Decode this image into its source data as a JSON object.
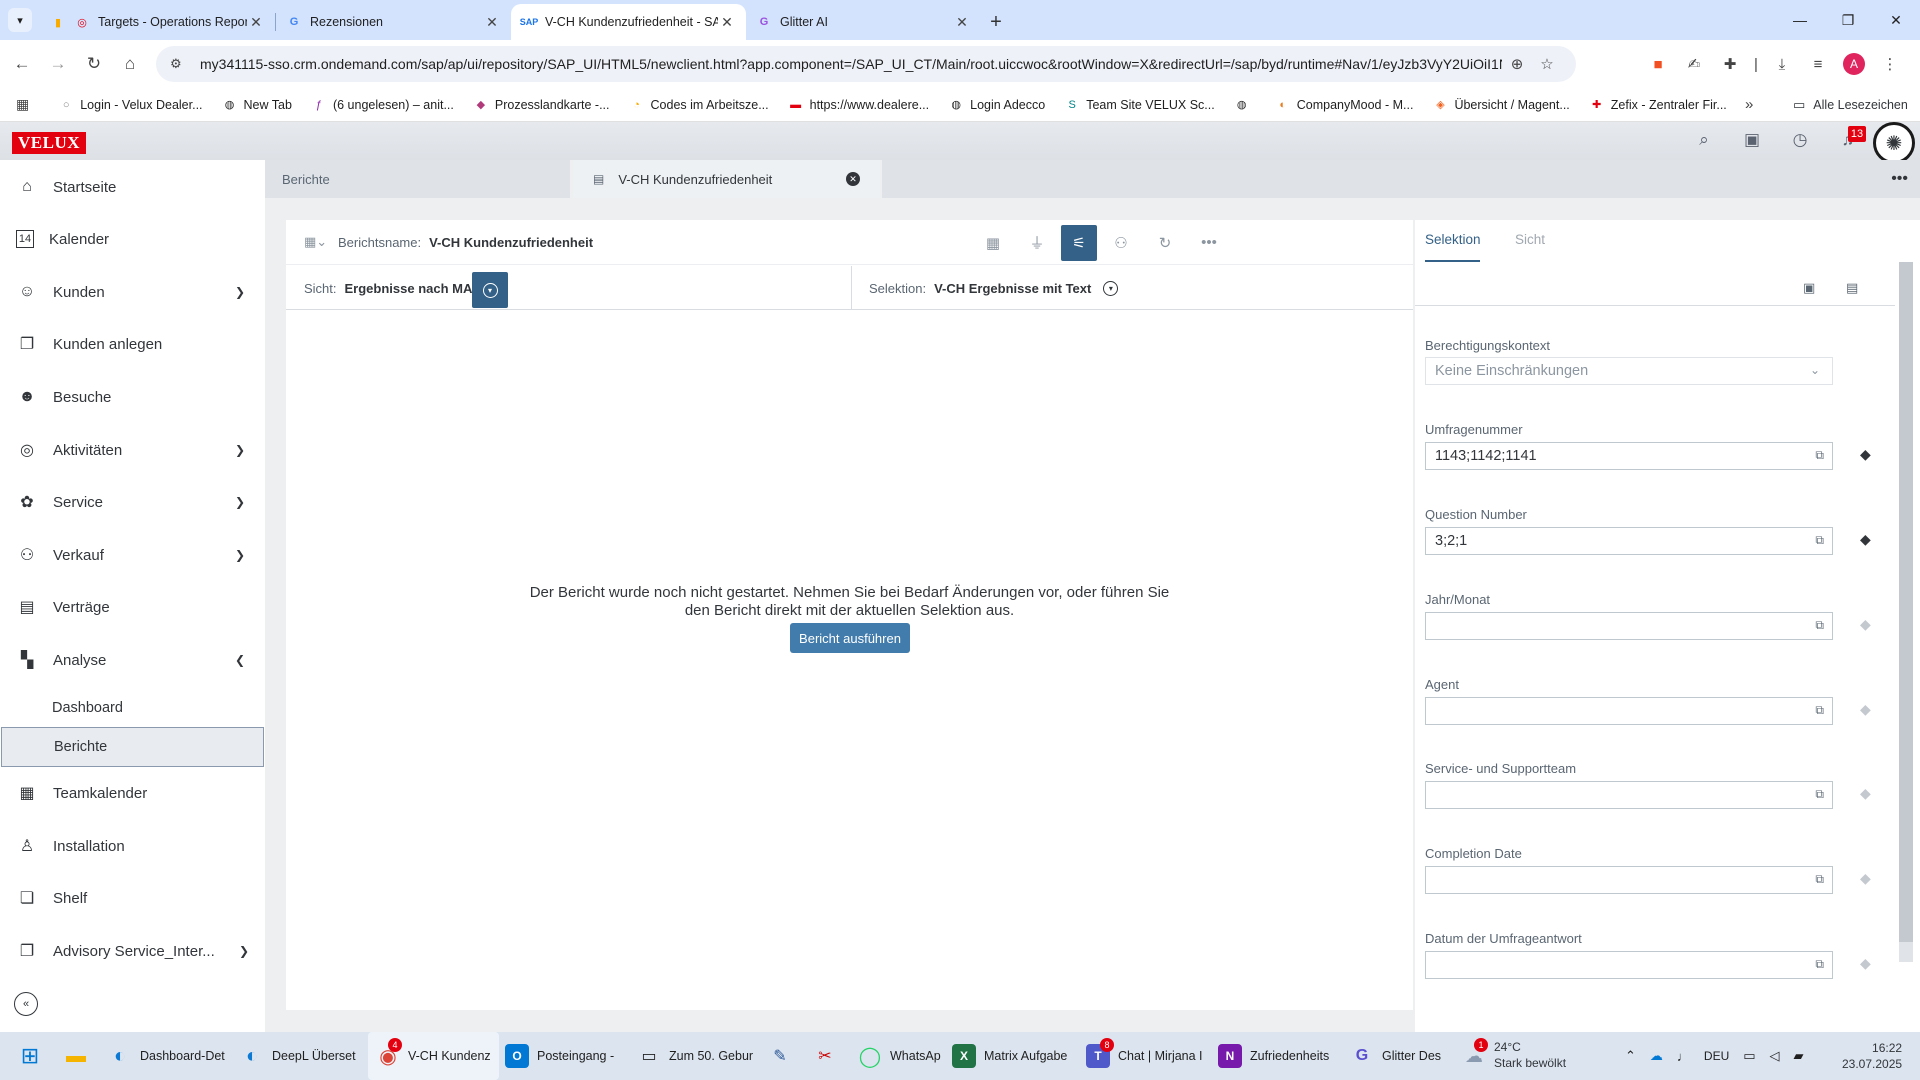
{
  "browser": {
    "tabs": [
      {
        "title": "Targets - Operations Report",
        "icon": "chart-icon",
        "color": "#f9ab00"
      },
      {
        "title": "Rezensionen",
        "icon": "google-icon",
        "color": "#4285f4"
      },
      {
        "title": "V-CH Kundenzufriedenheit - SAP",
        "icon": "sap-icon",
        "color": "#1a73e8"
      },
      {
        "title": "Glitter AI",
        "icon": "glitter-icon",
        "color": "#9b51e0"
      }
    ],
    "url": "my341115-sso.crm.ondemand.com/sap/ap/ui/repository/SAP_UI/HTML5/newclient.html?app.component=/SAP_UI_CT/Main/root.uiccwoc&rootWindow=X&redirectUrl=/sap/byd/runtime#Nav/1/eyJzb3VyY2UiOiI1NiQvU0...",
    "avatar_letter": "A",
    "bookmarks": [
      "Login - Velux Dealer...",
      "New Tab",
      "(6 ungelesen) – anit...",
      "Prozesslandkarte -...",
      "Codes im Arbeitsze...",
      "https://www.dealere...",
      "Login Adecco",
      "Team Site VELUX Sc...",
      "",
      "CompanyMood - M...",
      "Übersicht / Magent...",
      "Zefix - Zentraler Fir..."
    ],
    "all_bookmarks": "Alle Lesezeichen"
  },
  "shell": {
    "logo": "VELUX",
    "notification_count": "13"
  },
  "sidebar": {
    "items": [
      {
        "label": "Startseite",
        "icon": "home-icon",
        "glyph": "⌂"
      },
      {
        "label": "Kalender",
        "icon": "calendar-icon",
        "glyph": "▦"
      },
      {
        "label": "Kunden",
        "icon": "customers-icon",
        "glyph": "☺"
      },
      {
        "label": "Kunden anlegen",
        "icon": "copy-icon",
        "glyph": "❐"
      },
      {
        "label": "Besuche",
        "icon": "visit-icon",
        "glyph": "☻"
      },
      {
        "label": "Aktivitäten",
        "icon": "activity-icon",
        "glyph": "◎"
      },
      {
        "label": "Service",
        "icon": "service-icon",
        "glyph": "✿"
      },
      {
        "label": "Verkauf",
        "icon": "sales-icon",
        "glyph": "⚇"
      },
      {
        "label": "Verträge",
        "icon": "contract-icon",
        "glyph": "▤"
      },
      {
        "label": "Analyse",
        "icon": "analysis-icon",
        "glyph": "▚"
      },
      {
        "label": "Teamkalender",
        "icon": "team-calendar-icon",
        "glyph": "▦"
      },
      {
        "label": "Installation",
        "icon": "installation-icon",
        "glyph": "♙"
      },
      {
        "label": "Shelf",
        "icon": "shelf-icon",
        "glyph": "❏"
      },
      {
        "label": "Advisory Service_Inter...",
        "icon": "advisory-icon",
        "glyph": "❐"
      }
    ],
    "sub_items": [
      "Dashboard",
      "Berichte"
    ]
  },
  "objtabs": {
    "tab1": "Berichte",
    "tab2": "V-CH Kundenzufriedenheit"
  },
  "report": {
    "name_label": "Berichtsname:",
    "name_value": "V-CH Kundenzufriedenheit",
    "sicht_label": "Sicht:",
    "sicht_value": "Ergebnisse nach MA",
    "selektion_label": "Selektion:",
    "selektion_value": "V-CH Ergebnisse mit Text",
    "empty_message_line1": "Der Bericht wurde noch nicht gestartet. Nehmen Sie bei Bedarf Änderungen vor, oder führen Sie",
    "empty_message_line2": "den Bericht direkt mit der aktuellen Selektion aus.",
    "run_button": "Bericht ausführen"
  },
  "filter": {
    "tab_selektion": "Selektion",
    "tab_sicht": "Sicht",
    "context_label": "Berechtigungskontext",
    "context_value": "Keine Einschränkungen",
    "fields": [
      {
        "label": "Umfragenummer",
        "value": "1143;1142;1141"
      },
      {
        "label": "Question Number",
        "value": "3;2;1"
      },
      {
        "label": "Jahr/Monat",
        "value": ""
      },
      {
        "label": "Agent",
        "value": ""
      },
      {
        "label": "Service- und Supportteam",
        "value": ""
      },
      {
        "label": "Completion Date",
        "value": ""
      },
      {
        "label": "Datum der Umfrageantwort",
        "value": ""
      }
    ]
  },
  "taskbar": {
    "items": [
      "Dashboard-Det",
      "DeepL Überset",
      "V-CH Kundenz",
      "Posteingang - ",
      "Zum 50. Gebur",
      "WhatsAp",
      "Matrix Aufgabe",
      "Chat | Mirjana I",
      "Zufriedenheits",
      "Glitter Des"
    ],
    "badges": {
      "chrome": "4",
      "teams": "8",
      "weather": "1"
    },
    "weather_temp": "24°C",
    "weather_text": "Stark bewölkt",
    "language": "DEU",
    "time": "16:22",
    "date": "23.07.2025"
  }
}
